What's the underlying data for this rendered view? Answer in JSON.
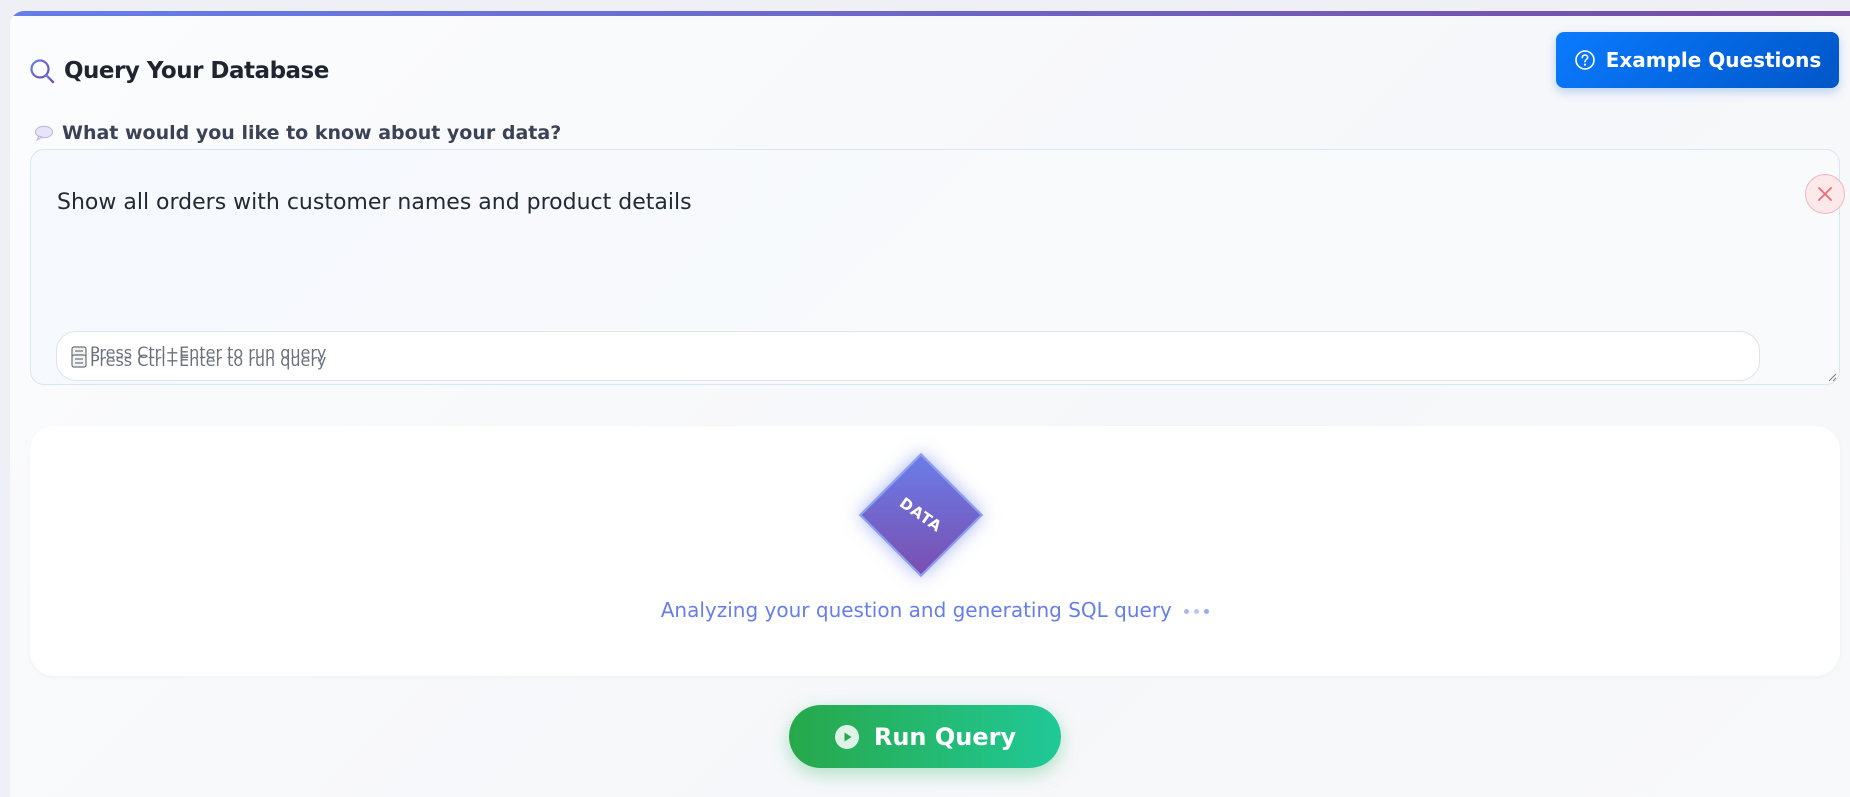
{
  "header": {
    "title": "Query Your Database",
    "icon": "search-icon",
    "example_button_label": "Example Questions",
    "example_button_icon": "question-circle-icon"
  },
  "question": {
    "label": "What would you like to know about your data?",
    "label_icon": "speech-bubble-icon",
    "input_value": "Show all orders with customer names and product details",
    "hint": "Press Ctrl+Enter to run query",
    "hint_icon": "keyboard-icon",
    "clear_icon": "close-icon"
  },
  "loading": {
    "badge_text": "DATA",
    "message": "Analyzing your question and generating SQL query"
  },
  "actions": {
    "run_label": "Run Query",
    "run_icon": "play-icon"
  },
  "colors": {
    "accent_start": "#667eea",
    "accent_end": "#764ba2",
    "primary_button": "#0a7bff",
    "run_button_start": "#27a84a",
    "run_button_end": "#20c997",
    "clear_button": "#f5b5bd"
  }
}
